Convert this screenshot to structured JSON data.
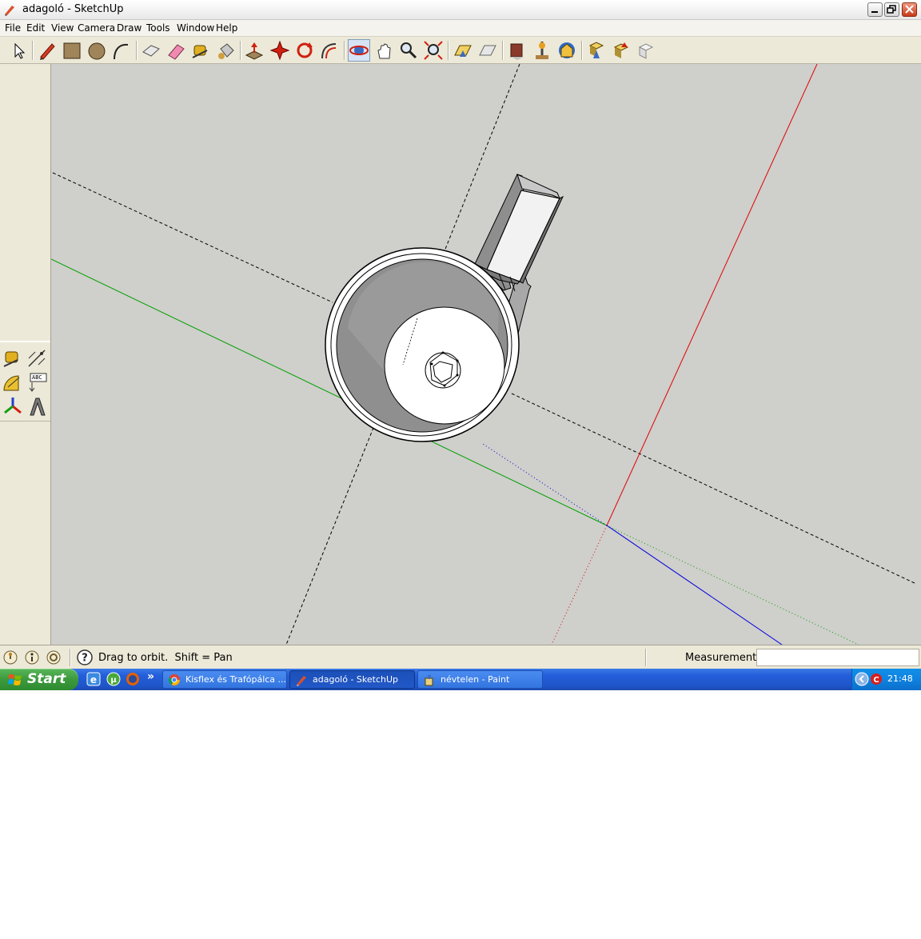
{
  "window": {
    "title": "adagoló - SketchUp"
  },
  "menu": {
    "items": [
      "File",
      "Edit",
      "View",
      "Camera",
      "Draw",
      "Tools",
      "Window",
      "Help"
    ]
  },
  "toolbar": {
    "tools": [
      "select-icon",
      "pencil-icon",
      "rectangle-icon",
      "circle-icon",
      "arc-icon",
      "make-component-icon",
      "eraser-icon",
      "tape-measure-icon",
      "paint-bucket-icon",
      "push-pull-icon",
      "move-icon",
      "rotate-icon",
      "offset-icon",
      "orbit-icon",
      "pan-icon",
      "zoom-icon",
      "zoom-extents-icon",
      "get-models-icon",
      "share-model-icon",
      "components-icon",
      "add-location-icon",
      "google-earth-icon",
      "get-photo-texture-icon",
      "share-component-icon",
      "preview-in-earth-icon"
    ],
    "active_tool": "orbit-icon"
  },
  "left_tools": {
    "tools": [
      "tape-measure-icon",
      "dimension-icon",
      "protractor-icon",
      "text-icon",
      "axes-icon",
      "3d-text-icon"
    ],
    "text_tool_label": "ABC"
  },
  "status": {
    "hint": "Drag to orbit.  Shift = Pan",
    "measurements_label": "Measurements",
    "measurements_value": ""
  },
  "taskbar": {
    "start_label": "Start",
    "quick_launch": [
      "ie-icon",
      "utorrent-icon",
      "firefox-icon"
    ],
    "overflow": "»",
    "tasks": [
      {
        "label": "Kisflex és Trafópálca ...",
        "icon": "chrome-icon",
        "active": false
      },
      {
        "label": "adagoló - SketchUp",
        "icon": "sketchup-icon",
        "active": true
      },
      {
        "label": "névtelen - Paint",
        "icon": "paint-icon",
        "active": false
      }
    ],
    "clock": "21:48"
  },
  "colors": {
    "viewport_bg": "#cfcfcb",
    "axis_red": "#e00000",
    "axis_green": "#00a000",
    "axis_blue": "#0000e0"
  }
}
